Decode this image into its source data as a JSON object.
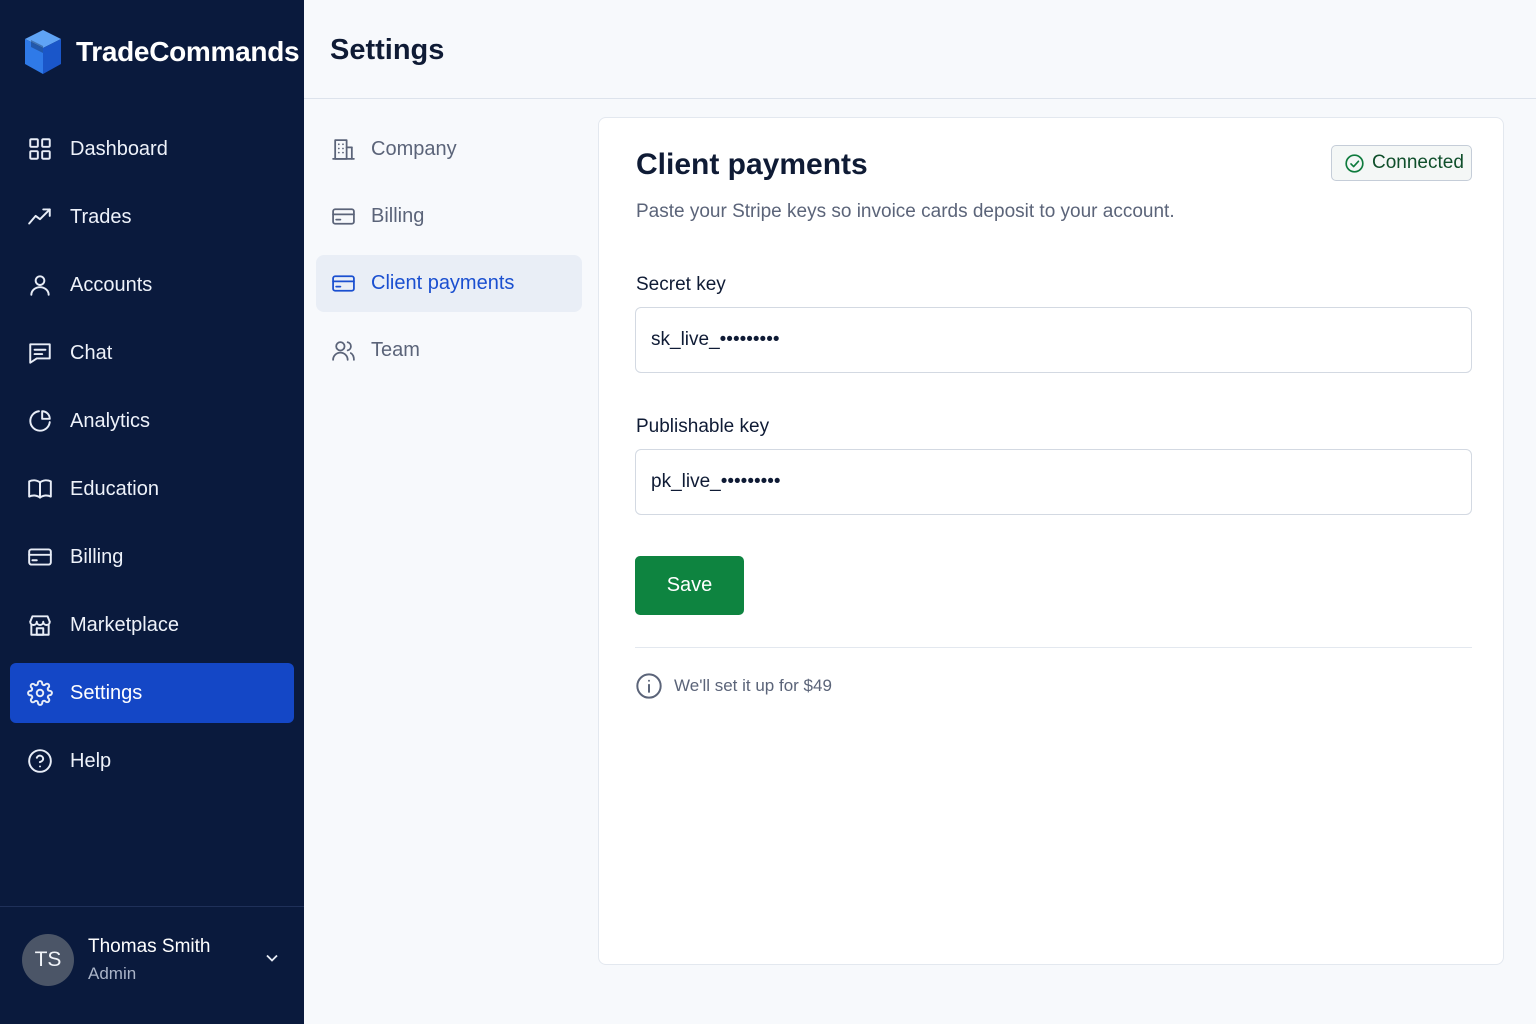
{
  "brand": {
    "name": "TradeCommands",
    "logo_icon": "cube-logo-icon",
    "accent": "#1f6fe5"
  },
  "sidebar": {
    "items": [
      {
        "label": "Dashboard",
        "icon": "dashboard-grid-icon"
      },
      {
        "label": "Trades",
        "icon": "trend-up-icon"
      },
      {
        "label": "Accounts",
        "icon": "user-icon"
      },
      {
        "label": "Chat",
        "icon": "chat-icon"
      },
      {
        "label": "Analytics",
        "icon": "pie-chart-icon"
      },
      {
        "label": "Education",
        "icon": "book-icon"
      },
      {
        "label": "Billing",
        "icon": "credit-card-icon"
      },
      {
        "label": "Marketplace",
        "icon": "store-icon"
      },
      {
        "label": "Settings",
        "icon": "gear-icon",
        "active": true
      },
      {
        "label": "Help",
        "icon": "help-circle-icon"
      }
    ],
    "active_color": "#1447c6",
    "background": "#0a1a3d"
  },
  "user": {
    "initials": "TS",
    "name": "Thomas Smith",
    "role": "Admin"
  },
  "header": {
    "title": "Settings"
  },
  "settings_nav": {
    "items": [
      {
        "label": "Company",
        "icon": "building-icon"
      },
      {
        "label": "Billing",
        "icon": "credit-card-icon"
      },
      {
        "label": "Client payments",
        "icon": "credit-card-icon",
        "active": true
      },
      {
        "label": "Team",
        "icon": "users-icon"
      }
    ]
  },
  "card": {
    "title": "Client payments",
    "subtitle": "Paste your Stripe keys so invoice cards deposit to your account.",
    "status_badge": {
      "label": "Connected",
      "icon": "check-circle-icon",
      "color": "#0e7b3d"
    },
    "secret_key": {
      "label": "Secret key",
      "value": "sk_live_•••••••••"
    },
    "publishable_key": {
      "label": "Publishable key",
      "value": "pk_live_•••••••••"
    },
    "save_label": "Save",
    "save_color": "#0e8440",
    "note": {
      "text": "We'll set it up for $49",
      "icon": "info-icon"
    }
  }
}
